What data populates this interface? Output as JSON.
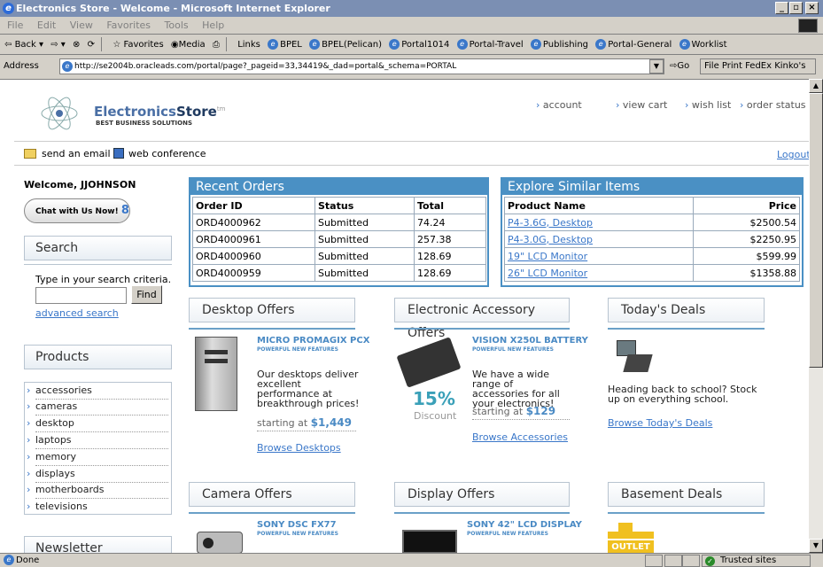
{
  "window": {
    "title": "Electronics Store - Welcome - Microsoft Internet Explorer"
  },
  "menu": [
    "File",
    "Edit",
    "View",
    "Favorites",
    "Tools",
    "Help"
  ],
  "toolbar": {
    "back": "Back",
    "favorites": "Favorites",
    "media": "Media",
    "links_label": "Links",
    "links": [
      "BPEL",
      "BPEL(Pelican)",
      "Portal1014",
      "Portal-Travel",
      "Publishing",
      "Portal-General",
      "Worklist"
    ]
  },
  "address": {
    "label": "Address",
    "url": "http://se2004b.oracleads.com/portal/page?_pageid=33,34419&_dad=portal&_schema=PORTAL",
    "go": "Go",
    "extra": "File Print FedEx Kinko's"
  },
  "header": {
    "logo_a": "Electronics",
    "logo_b": "Store",
    "logo_tm": "tm",
    "logo_sub": "BEST BUSINESS SOLUTIONS",
    "links": [
      "account",
      "view cart",
      "wish list",
      "order status"
    ],
    "send_email": "send an email",
    "web_conference": "web conference",
    "logout": "Logout"
  },
  "sidebar": {
    "welcome": "Welcome, JJOHNSON",
    "chat": "Chat with Us Now!",
    "search_title": "Search",
    "search_hint": "Type in your search criteria.",
    "find": "Find",
    "advanced": "advanced search",
    "products_title": "Products",
    "categories": [
      "accessories",
      "cameras",
      "desktop",
      "laptops",
      "memory",
      "displays",
      "motherboards",
      "televisions"
    ],
    "newsletter_title": "Newsletter"
  },
  "recent_orders": {
    "title": "Recent Orders",
    "columns": [
      "Order ID",
      "Status",
      "Total"
    ],
    "rows": [
      [
        "ORD4000962",
        "Submitted",
        "74.24"
      ],
      [
        "ORD4000961",
        "Submitted",
        "257.38"
      ],
      [
        "ORD4000960",
        "Submitted",
        "128.69"
      ],
      [
        "ORD4000959",
        "Submitted",
        "128.69"
      ]
    ]
  },
  "similar_items": {
    "title": "Explore Similar Items",
    "columns": [
      "Product Name",
      "Price"
    ],
    "rows": [
      [
        "P4-3.6G, Desktop",
        "$2500.54"
      ],
      [
        "P4-3.0G, Desktop",
        "$2250.95"
      ],
      [
        "19\" LCD Monitor",
        "$599.99"
      ],
      [
        "26\" LCD Monitor",
        "$1358.88"
      ]
    ]
  },
  "offers": {
    "desktop": {
      "title": "Desktop Offers",
      "product": "MICRO PROMAGIX PCX",
      "sub": "POWERFUL NEW FEATURES",
      "desc": "Our desktops deliver excellent performance at breakthrough prices!",
      "starting": "starting at",
      "price": "$1,449",
      "browse": "Browse Desktops"
    },
    "accessory": {
      "title": "Electronic Accessory Offers",
      "product": "VISION X250L BATTERY",
      "sub": "POWERFUL NEW FEATURES",
      "discount_pct": "15%",
      "discount_label": "Discount",
      "desc": "We have a wide range of accessories for all your electronics!",
      "starting": "starting at",
      "price": "$129",
      "browse": "Browse Accessories"
    },
    "deals": {
      "title": "Today's Deals",
      "desc": "Heading back to school? Stock up on everything school.",
      "browse": "Browse Today's Deals"
    },
    "camera": {
      "title": "Camera Offers",
      "product": "SONY DSC FX77",
      "sub": "POWERFUL NEW FEATURES"
    },
    "display": {
      "title": "Display Offers",
      "product": "SONY 42\" LCD DISPLAY",
      "sub": "POWERFUL NEW FEATURES"
    },
    "basement": {
      "title": "Basement Deals",
      "badge": "OUTLET"
    }
  },
  "status": {
    "text": "Done",
    "zone": "Trusted sites"
  }
}
